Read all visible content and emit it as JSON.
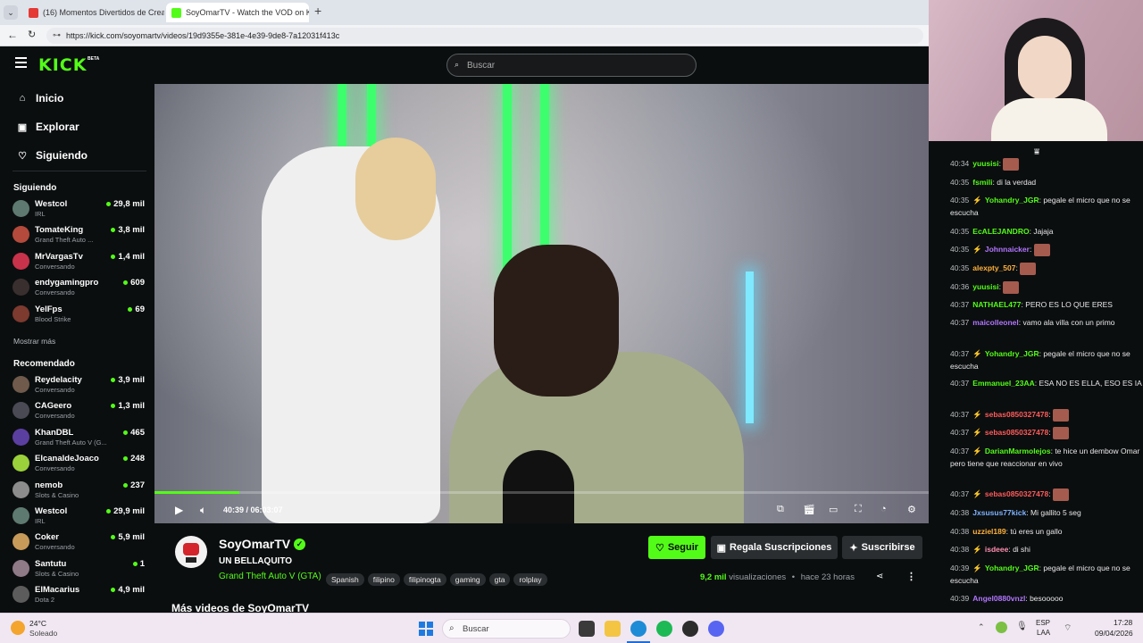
{
  "browser": {
    "tabs": [
      {
        "title": "(16) Momentos Divertidos de Crea",
        "active": false
      },
      {
        "title": "SoyOmarTV - Watch the VOD on K",
        "active": true
      }
    ],
    "new_tab": "+",
    "url": "https://kick.com/soyomartv/videos/19d9355e-381e-4e39-9de8-7a12031f413c"
  },
  "header": {
    "logo": "KICK",
    "logo_badge": "BETA",
    "search_placeholder": "Buscar"
  },
  "sidebar": {
    "nav": [
      {
        "label": "Inicio",
        "icon": "home-icon"
      },
      {
        "label": "Explorar",
        "icon": "compass-icon"
      },
      {
        "label": "Siguiendo",
        "icon": "heart-icon"
      }
    ],
    "following_title": "Siguiendo",
    "following": [
      {
        "name": "Westcol",
        "category": "IRL",
        "viewers": "29,8 mil",
        "color": "#5e7a70"
      },
      {
        "name": "TomateKing",
        "category": "Grand Theft Auto ...",
        "viewers": "3,8 mil",
        "color": "#b34a3b"
      },
      {
        "name": "MrVargasTv",
        "category": "Conversando",
        "viewers": "1,4 mil",
        "color": "#c8324a"
      },
      {
        "name": "endygamingpro",
        "category": "Conversando",
        "viewers": "609",
        "color": "#3a2f2f"
      },
      {
        "name": "YelFps",
        "category": "Blood Strike",
        "viewers": "69",
        "color": "#7d3a2e"
      }
    ],
    "show_more": "Mostrar más",
    "recommended_title": "Recomendado",
    "recommended": [
      {
        "name": "Reydelacity",
        "category": "Conversando",
        "viewers": "3,9 mil",
        "color": "#6f5a4b"
      },
      {
        "name": "CAGeero",
        "category": "Conversando",
        "viewers": "1,3 mil",
        "color": "#4a4a55"
      },
      {
        "name": "KhanDBL",
        "category": "Grand Theft Auto V (G...",
        "viewers": "465",
        "color": "#5b3fa0"
      },
      {
        "name": "ElcanaldeJoaco",
        "category": "Conversando",
        "viewers": "248",
        "color": "#9bd13a"
      },
      {
        "name": "nemob",
        "category": "Slots & Casino",
        "viewers": "237",
        "color": "#8c8c8c"
      },
      {
        "name": "Westcol",
        "category": "IRL",
        "viewers": "29,9 mil",
        "color": "#5e7a70"
      },
      {
        "name": "Coker",
        "category": "Conversando",
        "viewers": "5,9 mil",
        "color": "#c79a5a"
      },
      {
        "name": "Santutu",
        "category": "Slots & Casino",
        "viewers": "1",
        "color": "#8f7a88"
      },
      {
        "name": "ElMacarius",
        "category": "Dota 2",
        "viewers": "4,9 mil",
        "color": "#5c5c5c"
      }
    ]
  },
  "player": {
    "time": "40:39 / 06:03:07",
    "progress": 0.11
  },
  "stream": {
    "channel": "SoyOmarTV",
    "title": "UN BELLAQUITO",
    "category": "Grand Theft Auto V (GTA)",
    "tags": [
      "Spanish",
      "filipino",
      "filipinogta",
      "gaming",
      "gta",
      "rolplay"
    ],
    "follow": "Seguir",
    "gift": "Regala Suscripciones",
    "subscribe": "Suscribirse",
    "views_count": "9,2 mil",
    "views_label": "visualizaciones",
    "age": "hace 23 horas",
    "more_videos": "Más videos de SoyOmarTV"
  },
  "chat": [
    {
      "time": "40:34",
      "user": "yuusisi",
      "color": "#53fc18",
      "text": "",
      "emote": true
    },
    {
      "time": "40:35",
      "user": "fsmili",
      "color": "#53fc18",
      "text": "di la verdad"
    },
    {
      "time": "40:35",
      "user": "Yohandry_JGR",
      "color": "#53fc18",
      "text": "pegale el micro que no se escucha",
      "badge": true
    },
    {
      "time": "40:35",
      "user": "EcALEJANDRO",
      "color": "#53fc18",
      "text": "Jajaja"
    },
    {
      "time": "40:35",
      "user": "Johnnaicker",
      "color": "#b176ff",
      "text": "",
      "emote": true,
      "badge": true
    },
    {
      "time": "40:35",
      "user": "alexpty_507",
      "color": "#ffb13b",
      "text": "",
      "emote": true
    },
    {
      "time": "40:36",
      "user": "yuusisi",
      "color": "#53fc18",
      "text": "",
      "emote": true
    },
    {
      "time": "40:37",
      "user": "NATHAEL477",
      "color": "#53fc18",
      "text": "PERO ES LO QUE ERES"
    },
    {
      "time": "40:37",
      "user": "maicolleonel",
      "color": "#b176ff",
      "text": "vamo ala villa con un primo"
    },
    {
      "time": "40:37",
      "user": "Yohandry_JGR",
      "color": "#53fc18",
      "text": "pegale el micro que no se escucha",
      "badge": true
    },
    {
      "time": "40:37",
      "user": "Emmanuel_23AA",
      "color": "#53fc18",
      "text": "ESA NO ES ELLA, ESO ES IA"
    },
    {
      "time": "40:37",
      "user": "sebas0850327478",
      "color": "#ff5a5a",
      "text": "",
      "emote": true,
      "badge": true
    },
    {
      "time": "40:37",
      "user": "sebas0850327478",
      "color": "#ff5a5a",
      "text": "",
      "emote": true,
      "badge": true
    },
    {
      "time": "40:37",
      "user": "DarianMarmolejos",
      "color": "#53fc18",
      "text": "te hice un dembow Omar pero tiene que reaccionar en vivo",
      "badge": true
    },
    {
      "time": "40:37",
      "user": "sebas0850327478",
      "color": "#ff5a5a",
      "text": "",
      "emote": true,
      "badge": true
    },
    {
      "time": "40:38",
      "user": "Jxsusus77kick",
      "color": "#7fb2ff",
      "text": "Mi gallito 5 seg"
    },
    {
      "time": "40:38",
      "user": "uzziel189",
      "color": "#ffb13b",
      "text": "tú eres un gallo"
    },
    {
      "time": "40:38",
      "user": "isdeee",
      "color": "#ff8fb0",
      "text": "di shi",
      "badge": true
    },
    {
      "time": "40:39",
      "user": "Yohandry_JGR",
      "color": "#53fc18",
      "text": "pegale el micro que no se escucha",
      "badge": true
    },
    {
      "time": "40:39",
      "user": "Angel0880vnzl",
      "color": "#b176ff",
      "text": "besooooo"
    }
  ],
  "taskbar": {
    "weather_temp": "24°C",
    "weather_desc": "Soleado",
    "search_placeholder": "Buscar",
    "lang": "ESP",
    "lang_sub": "LAA",
    "time": "17:28",
    "date": "09/04/2026"
  }
}
